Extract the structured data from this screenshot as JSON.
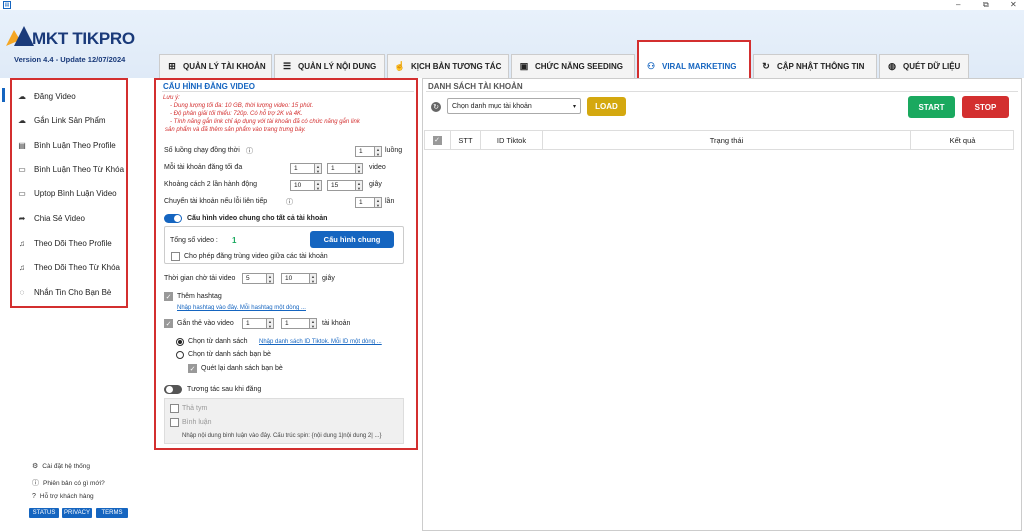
{
  "window": {
    "minimize": "–",
    "maximize": "⧉",
    "close": "✕",
    "app_icon": "app-icon"
  },
  "header": {
    "logo_text": "MKT TIKPRO",
    "version": "Version  4.4  - Update  12/07/2024"
  },
  "tabs": [
    {
      "label": "QUẢN LÝ TÀI KHOẢN",
      "icon": "⊞"
    },
    {
      "label": "QUẢN LÝ NỘI DUNG",
      "icon": "☰"
    },
    {
      "label": "KỊCH BẢN TƯƠNG TÁC",
      "icon": "☝"
    },
    {
      "label": "CHỨC NĂNG SEEDING",
      "icon": "▣"
    },
    {
      "label": "VIRAL MARKETING",
      "icon": "⚇"
    },
    {
      "label": "CẬP NHẬT THÔNG TIN",
      "icon": "↻"
    },
    {
      "label": "QUÉT DỮ LIỆU",
      "icon": "◍"
    }
  ],
  "sidebar": {
    "items": [
      {
        "label": "Đăng Video",
        "icon": "☁"
      },
      {
        "label": "Gắn Link Sản Phẩm",
        "icon": "☁"
      },
      {
        "label": "Bình Luận Theo Profile",
        "icon": "▤"
      },
      {
        "label": "Bình Luận Theo Từ Khóa",
        "icon": "▭"
      },
      {
        "label": "Uptop Bình Luận Video",
        "icon": "▭"
      },
      {
        "label": "Chia Sẻ Video",
        "icon": "➦"
      },
      {
        "label": "Theo Dõi Theo Profile",
        "icon": "♫"
      },
      {
        "label": "Theo Dõi Theo Từ Khóa",
        "icon": "♫"
      },
      {
        "label": "Nhắn Tin Cho Bạn Bè",
        "icon": "◌"
      }
    ],
    "footer_links": [
      {
        "label": "Cài đặt hệ thống",
        "icon": "⚙"
      },
      {
        "label": "Phiên bản có gì mới?",
        "icon": "ⓘ"
      },
      {
        "label": "Hỗ trợ khách hàng",
        "icon": "?"
      }
    ],
    "badges": [
      "STATUS",
      "PRIVACY",
      "TERMS"
    ]
  },
  "config": {
    "title": "CẤU HÌNH ĐĂNG VIDEO",
    "notes": [
      "Lưu ý:",
      "- Dung lượng tối đa: 10 GB, thời lượng video: 15 phút.",
      "- Độ phân giải tối thiểu: 720p. Có hỗ trợ 2K và 4K.",
      "- Tính năng gắn link chỉ áp dụng với tài khoản đã có chức năng gắn link",
      "sản phẩm và đã thêm sản phẩm vào trang trưng bày."
    ],
    "threads": {
      "label": "Số luồng chạy đồng thời",
      "value": "1",
      "unit": "luồng"
    },
    "videos_per_account": {
      "label": "Mỗi tài khoản đăng tối đa",
      "min": "1",
      "max": "1",
      "unit": "video"
    },
    "delay": {
      "label": "Khoảng cách 2 lần hành động",
      "min": "10",
      "max": "15",
      "unit": "giây"
    },
    "switch_on_error": {
      "label": "Chuyển tài khoản nếu lỗi liên tiếp",
      "value": "1",
      "unit": "lần"
    },
    "common_toggle": {
      "label": "Cấu hình video chung cho tất cả tài khoản",
      "on": true
    },
    "total_videos_label": "Tổng số video :",
    "total_videos": "1",
    "common_button": "Cấu hình chung",
    "allow_duplicate": "Cho phép đăng trùng video giữa các tài khoản",
    "upload_wait": {
      "label": "Thời gian chờ tải video",
      "min": "5",
      "max": "10",
      "unit": "giây"
    },
    "hashtag": {
      "label": "Thêm hashtag",
      "link": "Nhập hashtag vào đây. Mỗi hashtag một dòng ..."
    },
    "tag": {
      "label": "Gắn thẻ vào video",
      "min": "1",
      "max": "1",
      "unit": "tài khoản"
    },
    "from_list": {
      "label": "Chọn từ danh sách",
      "link": "Nhập danh sách ID Tiktok. Mỗi ID một dòng ..."
    },
    "from_friends": "Chọn từ danh sách bạn bè",
    "rescan_friends": "Quét lại danh sách bạn bè",
    "interact_toggle": {
      "label": "Tương tác sau khi đăng",
      "on": false
    },
    "heart": "Thả tym",
    "comment": "Bình luận",
    "comment_placeholder": "Nhập nội dung bình luận vào đây. Cấu trúc spin: {nội dung 1|nội dung 2| ...}"
  },
  "account_list": {
    "title": "DANH SÁCH TÀI KHOẢN",
    "category_select": "Chọn danh mục tài khoản",
    "load": "LOAD",
    "start": "START",
    "stop": "STOP",
    "columns": [
      "STT",
      "ID Tiktok",
      "Trạng thái",
      "Kết quả"
    ]
  },
  "colors": {
    "accent": "#1565c0",
    "red_box": "#d32f2f",
    "load": "#d4a80f",
    "start": "#1aa95f",
    "stop": "#d32f2f"
  }
}
